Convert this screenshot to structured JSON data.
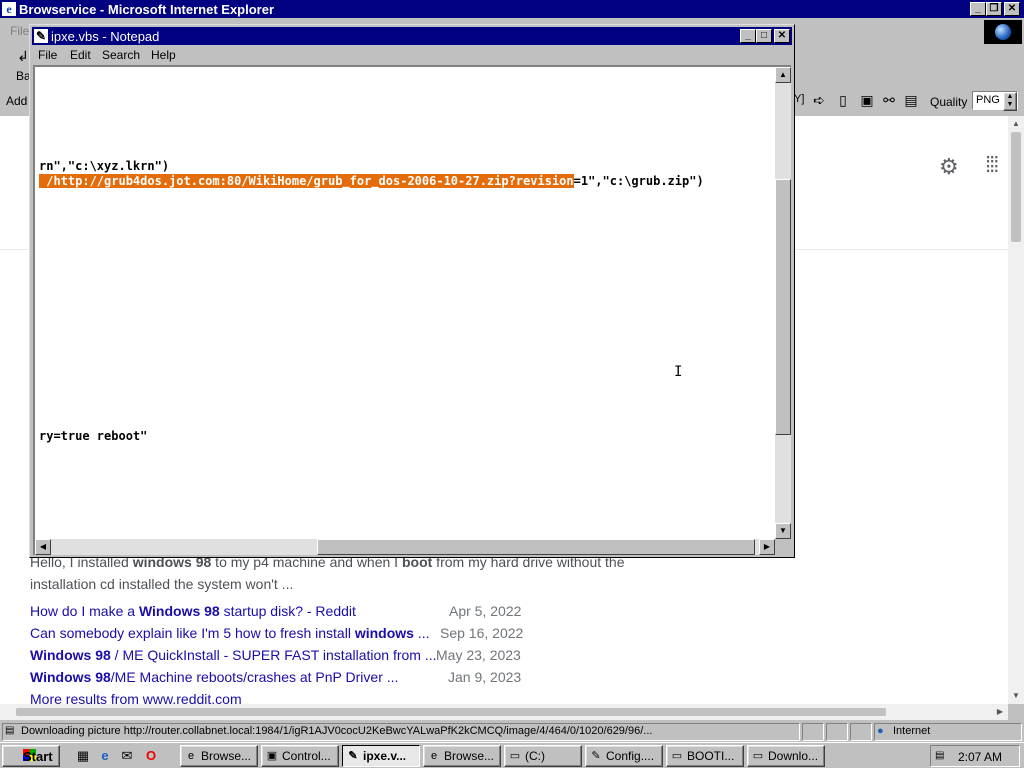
{
  "ie": {
    "title": "Browservice - Microsoft Internet Explorer",
    "menu": {
      "file": "File"
    },
    "toolbar": {
      "back_label": "Ba",
      "quality_label": "Quality",
      "quality_value": "PNG"
    },
    "address": {
      "label": "Add"
    },
    "content": {
      "snippet_line1_parts": [
        "Hello, I installed ",
        "windows 98",
        " to my p4 machine and when I ",
        "boot",
        " from my hard drive without the"
      ],
      "snippet_line2": "installation cd installed the system won't ...",
      "results": [
        {
          "pre": "How do I make a ",
          "bold": "Windows 98",
          "post": " startup disk? - Reddit",
          "date": "Apr 5, 2022"
        },
        {
          "pre": "Can somebody explain like I'm 5 how to fresh install ",
          "bold": "windows",
          "post": " ...",
          "date": "Sep 16, 2022"
        },
        {
          "pre": "",
          "bold": "Windows 98",
          "post": " / ME QuickInstall - SUPER FAST installation from ...",
          "date": "May 23, 2023"
        },
        {
          "pre": "",
          "bold": "Windows 98",
          "post": "/ME Machine reboots/crashes at PnP Driver ...",
          "date": "Jan 9, 2023"
        }
      ],
      "more": "More results from www.reddit.com"
    },
    "status": {
      "text": "Downloading picture http://router.collabnet.local:1984/1/igR1AJV0cocU2KeBwcYALwaPfK2kCMCQ/image/4/464/0/1020/629/96/...",
      "zone": "Internet"
    }
  },
  "notepad": {
    "title": "ipxe.vbs - Notepad",
    "menu": {
      "file": "File",
      "edit": "Edit",
      "search": "Search",
      "help": "Help"
    },
    "lines": {
      "line1": "rn\",\"c:\\xyz.lkrn\")",
      "line2_selected": " /http://grub4dos.jot.com:80/WikiHome/grub_for_dos-2006-10-27.zip?revision",
      "line2_rest": "=1\",\"c:\\grub.zip\")",
      "line3": "ry=true reboot\""
    }
  },
  "taskbar": {
    "start": "Start",
    "tasks": [
      "Browse...",
      "Control...",
      "ipxe.v...",
      "Browse...",
      "(C:)",
      "Config....",
      "BOOTI...",
      "Downlo..."
    ],
    "clock": "2:07 AM"
  }
}
